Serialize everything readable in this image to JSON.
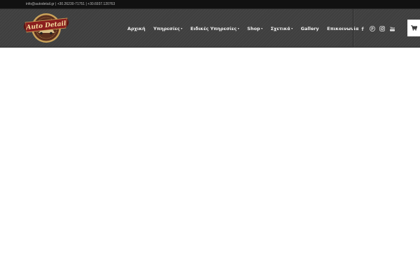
{
  "topbar": {
    "contact": "info@autodetail.gr | +30.26230-71751 | +30.6937.120763"
  },
  "logo": {
    "text": "Auto Detail",
    "colors": {
      "badge": "#5a2f1e",
      "ring": "#c9a25a",
      "ribbon": "#8b1e1e"
    }
  },
  "nav": {
    "items": [
      {
        "label": "Αρχική",
        "dropdown": ""
      },
      {
        "label": "Υπηρεσίες",
        "dropdown": "▾"
      },
      {
        "label": "Ειδικές Υπηρεσίες",
        "dropdown": "▾"
      },
      {
        "label": "Shop",
        "dropdown": "▾"
      },
      {
        "label": "Σχετικά",
        "dropdown": "▾"
      },
      {
        "label": "Gallery",
        "dropdown": ""
      },
      {
        "label": "Επικοινωνία",
        "dropdown": ""
      }
    ]
  },
  "social": {
    "icons": [
      "facebook-icon",
      "pinterest-icon",
      "instagram-icon",
      "youtube-icon"
    ],
    "glyphs": {
      "facebook": "f",
      "pinterest": "P",
      "youtube": "You"
    }
  },
  "cart": {
    "icon": "cart-icon"
  },
  "colors": {
    "topbar": "#111111",
    "header": "#3f3f3f",
    "nav_text": "#f1f1f1",
    "page": "#ffffff"
  }
}
